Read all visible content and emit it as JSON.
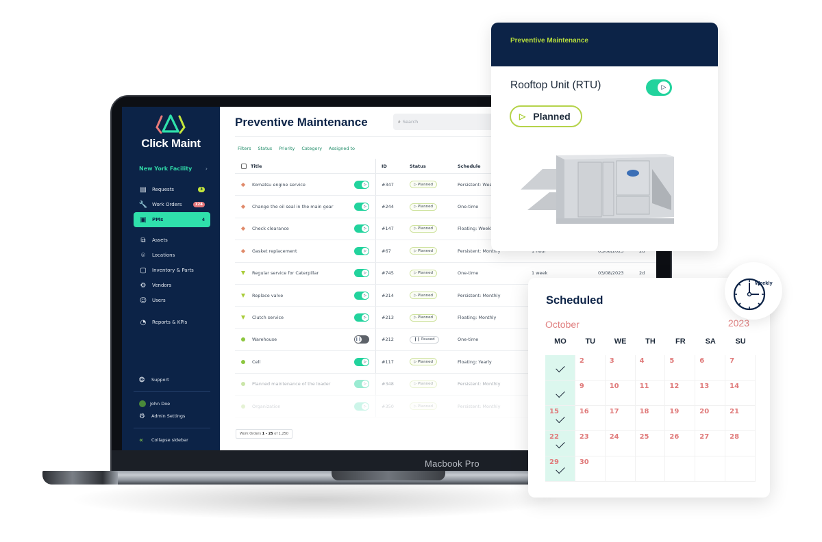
{
  "laptop": {
    "brand_label": "Macbook Pro"
  },
  "sidebar": {
    "brand": "Click Maint",
    "facility": "New York Facility",
    "facility_chevron": "›",
    "items": [
      {
        "label": "Requests",
        "icon": "requests-icon",
        "glyph": "▤",
        "badge": "3",
        "badge_color": "#c5e63c"
      },
      {
        "label": "Work Orders",
        "icon": "wrench-icon",
        "glyph": "🔧",
        "badge": "124",
        "badge_color": "#e4767a"
      },
      {
        "label": "PMs",
        "icon": "pm-icon",
        "glyph": "▣",
        "count": "4",
        "active": true
      },
      {
        "label": "Assets",
        "icon": "assets-icon",
        "glyph": "⧉"
      },
      {
        "label": "Locations",
        "icon": "location-icon",
        "glyph": "⌾"
      },
      {
        "label": "Inventory & Parts",
        "icon": "box-icon",
        "glyph": "▢"
      },
      {
        "label": "Vendors",
        "icon": "vendors-icon",
        "glyph": "⚙"
      },
      {
        "label": "Users",
        "icon": "users-icon",
        "glyph": "☺"
      },
      {
        "label": "Reports & KPIs",
        "icon": "reports-icon",
        "glyph": "◔"
      }
    ],
    "footer": {
      "support": "Support",
      "user": "John Doe",
      "admin": "Admin Settings",
      "collapse": "Collapse sidebar"
    }
  },
  "main": {
    "title": "Preventive Maintenance",
    "search_placeholder": "Search",
    "filters": [
      "Filters",
      "Status",
      "Priority",
      "Category",
      "Assigned to"
    ],
    "columns": {
      "title": "Title",
      "id": "ID",
      "status": "Status",
      "schedule": "Schedule"
    },
    "rows": [
      {
        "title": "Komatsu engine service",
        "priority": "high",
        "enabled": true,
        "id": "#347",
        "status": "Planned",
        "schedule": "Persistent: Weekly",
        "estimate": "",
        "date": "",
        "due": ""
      },
      {
        "title": "Change the oil seal in the main gear",
        "priority": "high",
        "enabled": true,
        "id": "#244",
        "status": "Planned",
        "schedule": "One-time",
        "estimate": "",
        "date": "",
        "due": ""
      },
      {
        "title": "Check clearance",
        "priority": "high",
        "enabled": true,
        "id": "#147",
        "status": "Planned",
        "schedule": "Floating: Weekly",
        "estimate": "",
        "date": "",
        "due": ""
      },
      {
        "title": "Gasket replacement",
        "priority": "high",
        "enabled": true,
        "id": "#67",
        "status": "Planned",
        "schedule": "Persistent: Monthly",
        "estimate": "1 hour",
        "date": "03/08/2023",
        "due": "2d"
      },
      {
        "title": "Regular service for Caterpillar",
        "priority": "med",
        "enabled": true,
        "id": "#745",
        "status": "Planned",
        "schedule": "One-time",
        "estimate": "1 week",
        "date": "03/08/2023",
        "due": "2d"
      },
      {
        "title": "Replace valve",
        "priority": "med",
        "enabled": true,
        "id": "#214",
        "status": "Planned",
        "schedule": "Persistent: Monthly",
        "estimate": "",
        "date": "",
        "due": ""
      },
      {
        "title": "Clutch service",
        "priority": "med",
        "enabled": true,
        "id": "#213",
        "status": "Planned",
        "schedule": "Floating: Monthly",
        "estimate": "",
        "date": "",
        "due": ""
      },
      {
        "title": "Warehouse",
        "priority": "low",
        "enabled": false,
        "id": "#212",
        "status": "Paused",
        "schedule": "One-time",
        "estimate": "",
        "date": "",
        "due": ""
      },
      {
        "title": "Cell",
        "priority": "low",
        "enabled": true,
        "id": "#117",
        "status": "Planned",
        "schedule": "Floating: Yearly",
        "estimate": "",
        "date": "",
        "due": ""
      },
      {
        "title": "Planned maintenance of the loader",
        "priority": "low",
        "enabled": true,
        "id": "#348",
        "status": "Planned",
        "schedule": "Persistent: Monthly",
        "estimate": "",
        "date": "",
        "due": "",
        "faded": 1
      },
      {
        "title": "Organization",
        "priority": "low",
        "enabled": true,
        "id": "#350",
        "status": "Planned",
        "schedule": "Persistent: Monthly",
        "estimate": "",
        "date": "",
        "due": "",
        "faded": 2
      }
    ],
    "pager": {
      "prefix": "Work Orders",
      "range": "1 - 25",
      "suffix": "of 1,250"
    }
  },
  "pm_card": {
    "header": "Preventive Maintenance",
    "asset_name": "Rooftop Unit (RTU)",
    "enabled": true,
    "status": "Planned",
    "colors": {
      "header_bg": "#0c2347",
      "header_text": "#b6dc3c",
      "toggle": "#22d39d",
      "status_border": "#b5d34a"
    }
  },
  "calendar": {
    "title": "Scheduled",
    "month": "October",
    "year": "2023",
    "frequency": "Weekly",
    "weekdays": [
      "MO",
      "TU",
      "WE",
      "TH",
      "FR",
      "SA",
      "SU"
    ],
    "weeks": [
      [
        "",
        "2",
        "3",
        "4",
        "5",
        "6",
        "7"
      ],
      [
        "",
        "9",
        "10",
        "11",
        "12",
        "13",
        "14"
      ],
      [
        "15",
        "16",
        "17",
        "18",
        "19",
        "20",
        "21"
      ],
      [
        "22",
        "23",
        "24",
        "25",
        "26",
        "27",
        "28"
      ],
      [
        "29",
        "30",
        "",
        "",
        "",
        "",
        ""
      ]
    ],
    "scheduled_weekday": "MO",
    "colors": {
      "date_text": "#e07a7a",
      "scheduled_bg": "#dcf7ee"
    }
  }
}
